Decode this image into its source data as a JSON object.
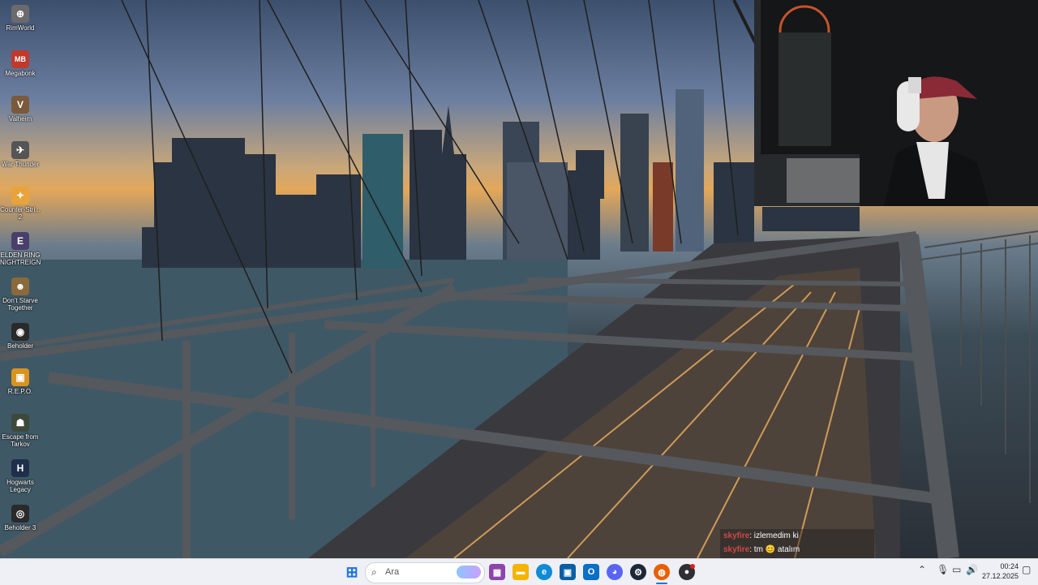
{
  "desktop": {
    "icons": [
      {
        "label": "RimWorld",
        "glyph": "⊕",
        "color": "#6b6b6b"
      },
      {
        "label": "Megabonk",
        "glyph": "MB",
        "color": "#c0392b"
      },
      {
        "label": "Valheim",
        "glyph": "V",
        "color": "#7a5a3a"
      },
      {
        "label": "War Thunder",
        "glyph": "✈",
        "color": "#555"
      },
      {
        "label": "Counter-Stri... 2",
        "glyph": "✦",
        "color": "#e8a33a"
      },
      {
        "label": "ELDEN RING NIGHTREIGN",
        "glyph": "E",
        "color": "#4a3f6b"
      },
      {
        "label": "Don't Starve Together",
        "glyph": "☻",
        "color": "#8a6a3a"
      },
      {
        "label": "Beholder",
        "glyph": "◉",
        "color": "#2a2a2a"
      },
      {
        "label": "R.E.P.O.",
        "glyph": "▣",
        "color": "#d8941f"
      },
      {
        "label": "Escape from Tarkov",
        "glyph": "☗",
        "color": "#3d4a3a"
      },
      {
        "label": "Hogwarts Legacy",
        "glyph": "H",
        "color": "#1f2f4a"
      },
      {
        "label": "Beholder 3",
        "glyph": "◎",
        "color": "#2a2a2a"
      }
    ]
  },
  "chat": {
    "messages": [
      {
        "user": "skyfire",
        "text": ": izlemedim ki"
      },
      {
        "user": "skyfire",
        "text": ": tm  😊  atalım"
      }
    ]
  },
  "taskbar": {
    "search_placeholder": "Ara",
    "apps": [
      {
        "name": "start-button",
        "glyph": "⊞",
        "color": "#1a73e8"
      },
      {
        "name": "widgets",
        "glyph": "▦",
        "color": "#8e44ad"
      },
      {
        "name": "file-explorer",
        "glyph": "▬",
        "color": "#f4b400"
      },
      {
        "name": "edge",
        "glyph": "e",
        "color": "#0f8ad6"
      },
      {
        "name": "store",
        "glyph": "▣",
        "color": "#0a5fa3"
      },
      {
        "name": "outlook",
        "glyph": "O",
        "color": "#0a6fc6"
      },
      {
        "name": "discord",
        "glyph": "◕",
        "color": "#5865f2"
      },
      {
        "name": "steam",
        "glyph": "⚙",
        "color": "#1b2838"
      },
      {
        "name": "firefox",
        "glyph": "◍",
        "color": "#e66000"
      },
      {
        "name": "obs",
        "glyph": "●",
        "color": "#302e31"
      }
    ],
    "clock_time": "00:24",
    "clock_date": "27.12.2025"
  }
}
